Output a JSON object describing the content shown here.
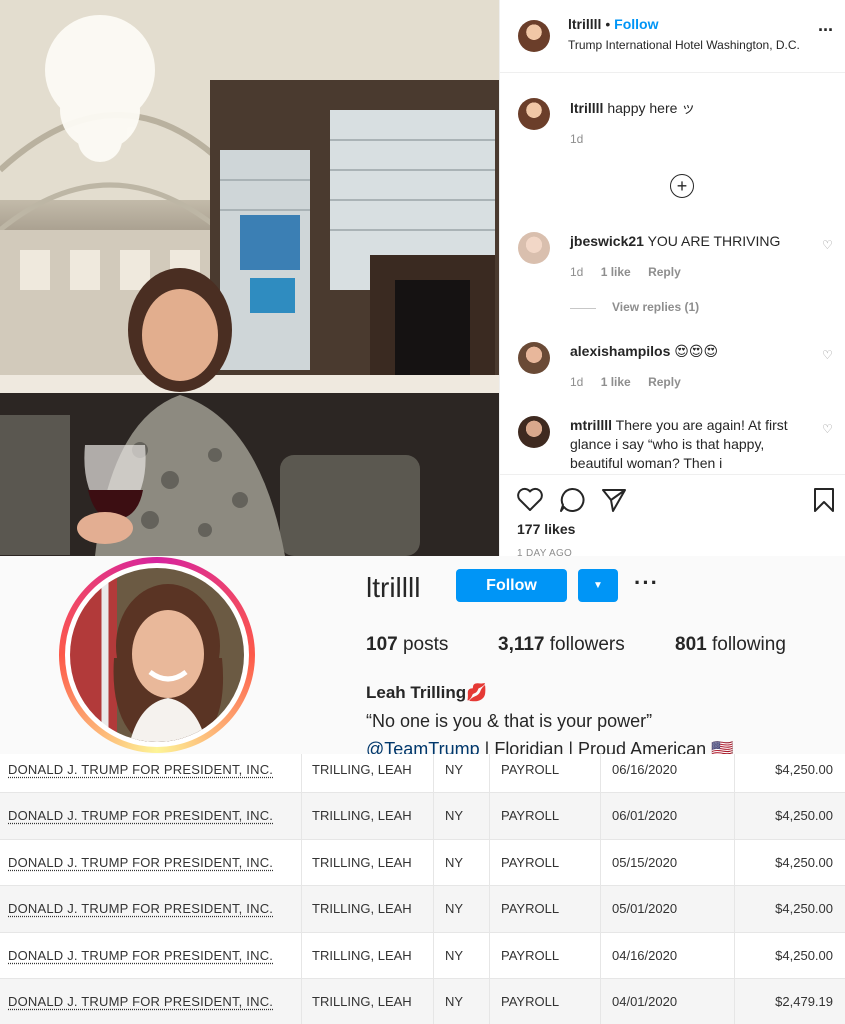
{
  "post": {
    "username": "ltrillll",
    "follow_label": "Follow",
    "location": "Trump International Hotel Washington, D.C.",
    "more_icon": "more-horizontal-icon",
    "caption": {
      "username": "ltrillll",
      "text": "happy here ッ",
      "time": "1d"
    },
    "add_icon": "plus-circle-icon",
    "comments": [
      {
        "username": "jbeswick21",
        "text": "YOU ARE THRIVING",
        "time": "1d",
        "likes": "1 like",
        "reply": "Reply",
        "view_replies": "View replies (1)"
      },
      {
        "username": "alexishampilos",
        "text": "😍😍😍",
        "time": "1d",
        "likes": "1 like",
        "reply": "Reply"
      },
      {
        "username": "mtrillll",
        "text": "There you are again! At first glance i say “who is that happy, beautiful woman? Then i"
      }
    ],
    "likes": "177 likes",
    "date": "1 DAY AGO"
  },
  "profile": {
    "username": "ltrillll",
    "follow_label": "Follow",
    "posts_count": "107",
    "posts_label": "posts",
    "followers_count": "3,117",
    "followers_label": "followers",
    "following_count": "801",
    "following_label": "following",
    "full_name": "Leah Trilling💋",
    "bio_line": "“No one is you & that is your power”",
    "bio_link": "@TeamTrump",
    "bio_rest": "| Floridian | Proud American 🇺🇸"
  },
  "table": {
    "rows": [
      {
        "committee": "DONALD J. TRUMP FOR PRESIDENT, INC.",
        "name": "TRILLING, LEAH",
        "state": "NY",
        "purpose": "PAYROLL",
        "date": "06/16/2020",
        "amount": "$4,250.00"
      },
      {
        "committee": "DONALD J. TRUMP FOR PRESIDENT, INC.",
        "name": "TRILLING, LEAH",
        "state": "NY",
        "purpose": "PAYROLL",
        "date": "06/01/2020",
        "amount": "$4,250.00"
      },
      {
        "committee": "DONALD J. TRUMP FOR PRESIDENT, INC.",
        "name": "TRILLING, LEAH",
        "state": "NY",
        "purpose": "PAYROLL",
        "date": "05/15/2020",
        "amount": "$4,250.00"
      },
      {
        "committee": "DONALD J. TRUMP FOR PRESIDENT, INC.",
        "name": "TRILLING, LEAH",
        "state": "NY",
        "purpose": "PAYROLL",
        "date": "05/01/2020",
        "amount": "$4,250.00"
      },
      {
        "committee": "DONALD J. TRUMP FOR PRESIDENT, INC.",
        "name": "TRILLING, LEAH",
        "state": "NY",
        "purpose": "PAYROLL",
        "date": "04/16/2020",
        "amount": "$4,250.00"
      },
      {
        "committee": "DONALD J. TRUMP FOR PRESIDENT, INC.",
        "name": "TRILLING, LEAH",
        "state": "NY",
        "purpose": "PAYROLL",
        "date": "04/01/2020",
        "amount": "$2,479.19"
      }
    ]
  }
}
